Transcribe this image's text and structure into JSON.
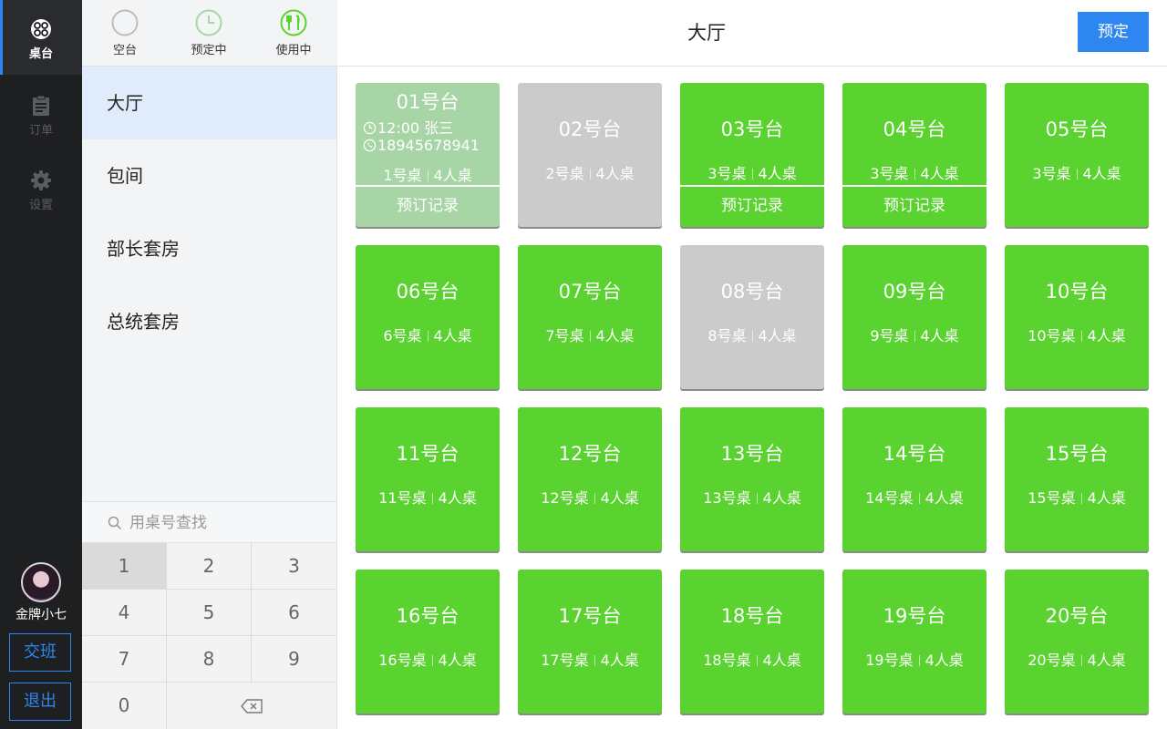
{
  "nav": {
    "items": [
      {
        "label": "桌台",
        "icon": "table-icon",
        "active": true
      },
      {
        "label": "订单",
        "icon": "clipboard-icon",
        "active": false
      },
      {
        "label": "设置",
        "icon": "gear-icon",
        "active": false
      }
    ],
    "username": "金牌小七",
    "handover_label": "交班",
    "logout_label": "退出"
  },
  "legend": {
    "items": [
      {
        "label": "空台",
        "icon": "empty-circle-icon"
      },
      {
        "label": "预定中",
        "icon": "clock-icon"
      },
      {
        "label": "使用中",
        "icon": "utensils-icon"
      }
    ]
  },
  "categories": [
    {
      "label": "大厅",
      "active": true
    },
    {
      "label": "包间",
      "active": false
    },
    {
      "label": "部长套房",
      "active": false
    },
    {
      "label": "总统套房",
      "active": false
    }
  ],
  "search": {
    "placeholder": "用桌号查找"
  },
  "keypad": {
    "keys": [
      "1",
      "2",
      "3",
      "4",
      "5",
      "6",
      "7",
      "8",
      "9",
      "0"
    ],
    "pressed": "1",
    "backspace_icon": "backspace-icon"
  },
  "header": {
    "title": "大厅",
    "book_label": "预定"
  },
  "colors": {
    "in_use": "#5ad22f",
    "empty": "#cbcbcb",
    "reserved": "#a7d5a5",
    "accent": "#2e86f0",
    "nav_bg": "#1e1f21"
  },
  "tables": [
    {
      "name": "01号台",
      "number": "1号桌",
      "size": "4人桌",
      "status": "reserved",
      "time_name": "12:00 张三",
      "phone": "18945678941",
      "record": "预订记录"
    },
    {
      "name": "02号台",
      "number": "2号桌",
      "size": "4人桌",
      "status": "empty"
    },
    {
      "name": "03号台",
      "number": "3号桌",
      "size": "4人桌",
      "status": "in_use",
      "record": "预订记录"
    },
    {
      "name": "04号台",
      "number": "3号桌",
      "size": "4人桌",
      "status": "in_use",
      "record": "预订记录"
    },
    {
      "name": "05号台",
      "number": "3号桌",
      "size": "4人桌",
      "status": "in_use"
    },
    {
      "name": "06号台",
      "number": "6号桌",
      "size": "4人桌",
      "status": "in_use"
    },
    {
      "name": "07号台",
      "number": "7号桌",
      "size": "4人桌",
      "status": "in_use"
    },
    {
      "name": "08号台",
      "number": "8号桌",
      "size": "4人桌",
      "status": "empty"
    },
    {
      "name": "09号台",
      "number": "9号桌",
      "size": "4人桌",
      "status": "in_use"
    },
    {
      "name": "10号台",
      "number": "10号桌",
      "size": "4人桌",
      "status": "in_use"
    },
    {
      "name": "11号台",
      "number": "11号桌",
      "size": "4人桌",
      "status": "in_use"
    },
    {
      "name": "12号台",
      "number": "12号桌",
      "size": "4人桌",
      "status": "in_use"
    },
    {
      "name": "13号台",
      "number": "13号桌",
      "size": "4人桌",
      "status": "in_use"
    },
    {
      "name": "14号台",
      "number": "14号桌",
      "size": "4人桌",
      "status": "in_use"
    },
    {
      "name": "15号台",
      "number": "15号桌",
      "size": "4人桌",
      "status": "in_use"
    },
    {
      "name": "16号台",
      "number": "16号桌",
      "size": "4人桌",
      "status": "in_use"
    },
    {
      "name": "17号台",
      "number": "17号桌",
      "size": "4人桌",
      "status": "in_use"
    },
    {
      "name": "18号台",
      "number": "18号桌",
      "size": "4人桌",
      "status": "in_use"
    },
    {
      "name": "19号台",
      "number": "19号桌",
      "size": "4人桌",
      "status": "in_use"
    },
    {
      "name": "20号台",
      "number": "20号桌",
      "size": "4人桌",
      "status": "in_use"
    }
  ]
}
